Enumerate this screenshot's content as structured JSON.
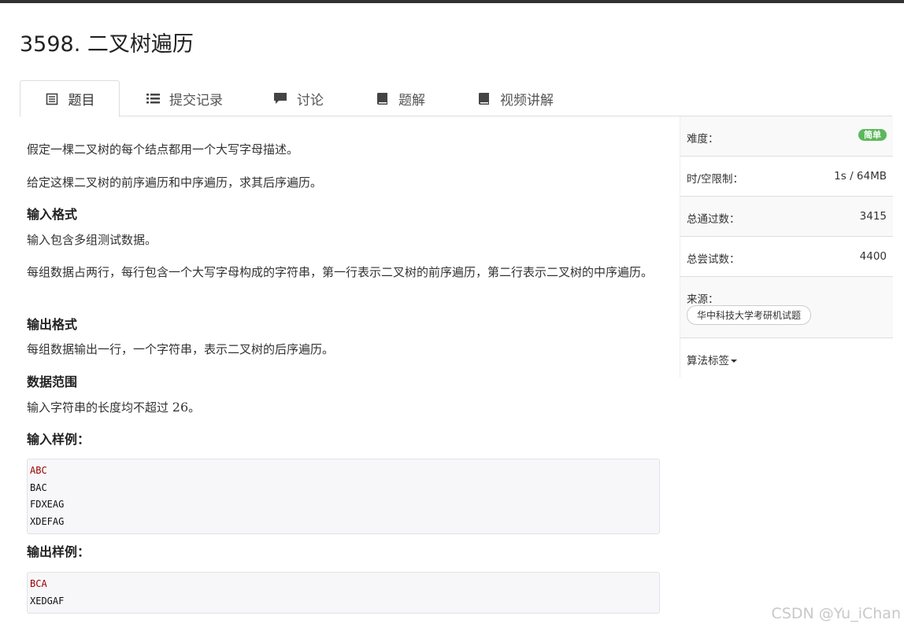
{
  "problem": {
    "title": "3598. 二叉树遍历"
  },
  "tabs": [
    {
      "label": "题目",
      "icon": "document-icon"
    },
    {
      "label": "提交记录",
      "icon": "list-icon"
    },
    {
      "label": "讨论",
      "icon": "comment-icon"
    },
    {
      "label": "题解",
      "icon": "book-icon"
    },
    {
      "label": "视频讲解",
      "icon": "book-icon"
    }
  ],
  "description": {
    "p1": "假定一棵二叉树的每个结点都用一个大写字母描述。",
    "p2": "给定这棵二叉树的前序遍历和中序遍历，求其后序遍历。",
    "input_heading": "输入格式",
    "input_p1": "输入包含多组测试数据。",
    "input_p2": "每组数据占两行，每行包含一个大写字母构成的字符串，第一行表示二叉树的前序遍历，第二行表示二叉树的中序遍历。",
    "output_heading": "输出格式",
    "output_p1": "每组数据输出一行，一个字符串，表示二叉树的后序遍历。",
    "range_heading": "数据范围",
    "range_text": "输入字符串的长度均不超过",
    "range_value": "26",
    "range_suffix": "。",
    "sample_input_heading": "输入样例：",
    "sample_input": [
      "ABC",
      "BAC",
      "FDXEAG",
      "XDEFAG"
    ],
    "sample_output_heading": "输出样例：",
    "sample_output": [
      "BCA",
      "XEDGAF"
    ]
  },
  "sidebar": {
    "difficulty_label": "难度：",
    "difficulty_value": "简单",
    "limit_label": "时/空限制：",
    "limit_value": "1s / 64MB",
    "passed_label": "总通过数：",
    "passed_value": "3415",
    "attempts_label": "总尝试数：",
    "attempts_value": "4400",
    "source_label": "来源：",
    "source_value": "华中科技大学考研机试题",
    "tags_label": "算法标签"
  },
  "watermark": "CSDN @Yu_iChan",
  "colors": {
    "easy_badge": "#5cb85c",
    "code_first_line": "#990000"
  }
}
